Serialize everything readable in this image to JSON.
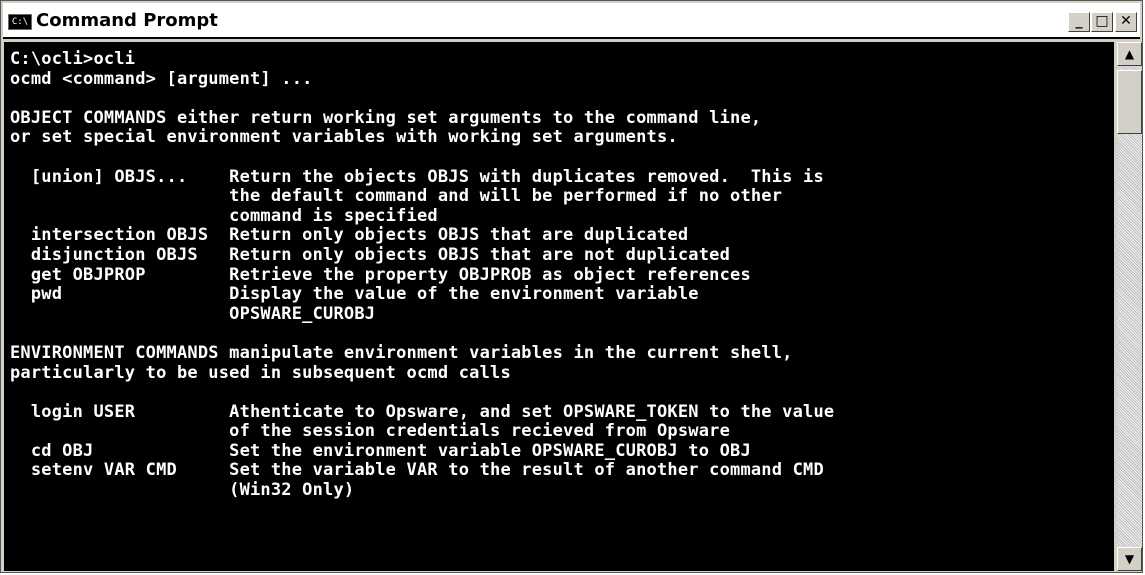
{
  "window": {
    "title": "Command Prompt",
    "icon_label": "C:\\",
    "minimize_glyph": "_",
    "maximize_glyph": "□",
    "close_glyph": "✕"
  },
  "terminal": {
    "lines": [
      "C:\\ocli>ocli",
      "ocmd <command> [argument] ...",
      "",
      "OBJECT COMMANDS either return working set arguments to the command line,",
      "or set special environment variables with working set arguments.",
      "",
      "  [union] OBJS...    Return the objects OBJS with duplicates removed.  This is",
      "                     the default command and will be performed if no other",
      "                     command is specified",
      "  intersection OBJS  Return only objects OBJS that are duplicated",
      "  disjunction OBJS   Return only objects OBJS that are not duplicated",
      "  get OBJPROP        Retrieve the property OBJPROB as object references",
      "  pwd                Display the value of the environment variable",
      "                     OPSWARE_CUROBJ",
      "",
      "ENVIRONMENT COMMANDS manipulate environment variables in the current shell,",
      "particularly to be used in subsequent ocmd calls",
      "",
      "  login USER         Athenticate to Opsware, and set OPSWARE_TOKEN to the value",
      "                     of the session credentials recieved from Opsware",
      "  cd OBJ             Set the environment variable OPSWARE_CUROBJ to OBJ",
      "  setenv VAR CMD     Set the variable VAR to the result of another command CMD",
      "                     (Win32 Only)"
    ]
  },
  "scrollbar": {
    "up_glyph": "▲",
    "down_glyph": "▼"
  }
}
